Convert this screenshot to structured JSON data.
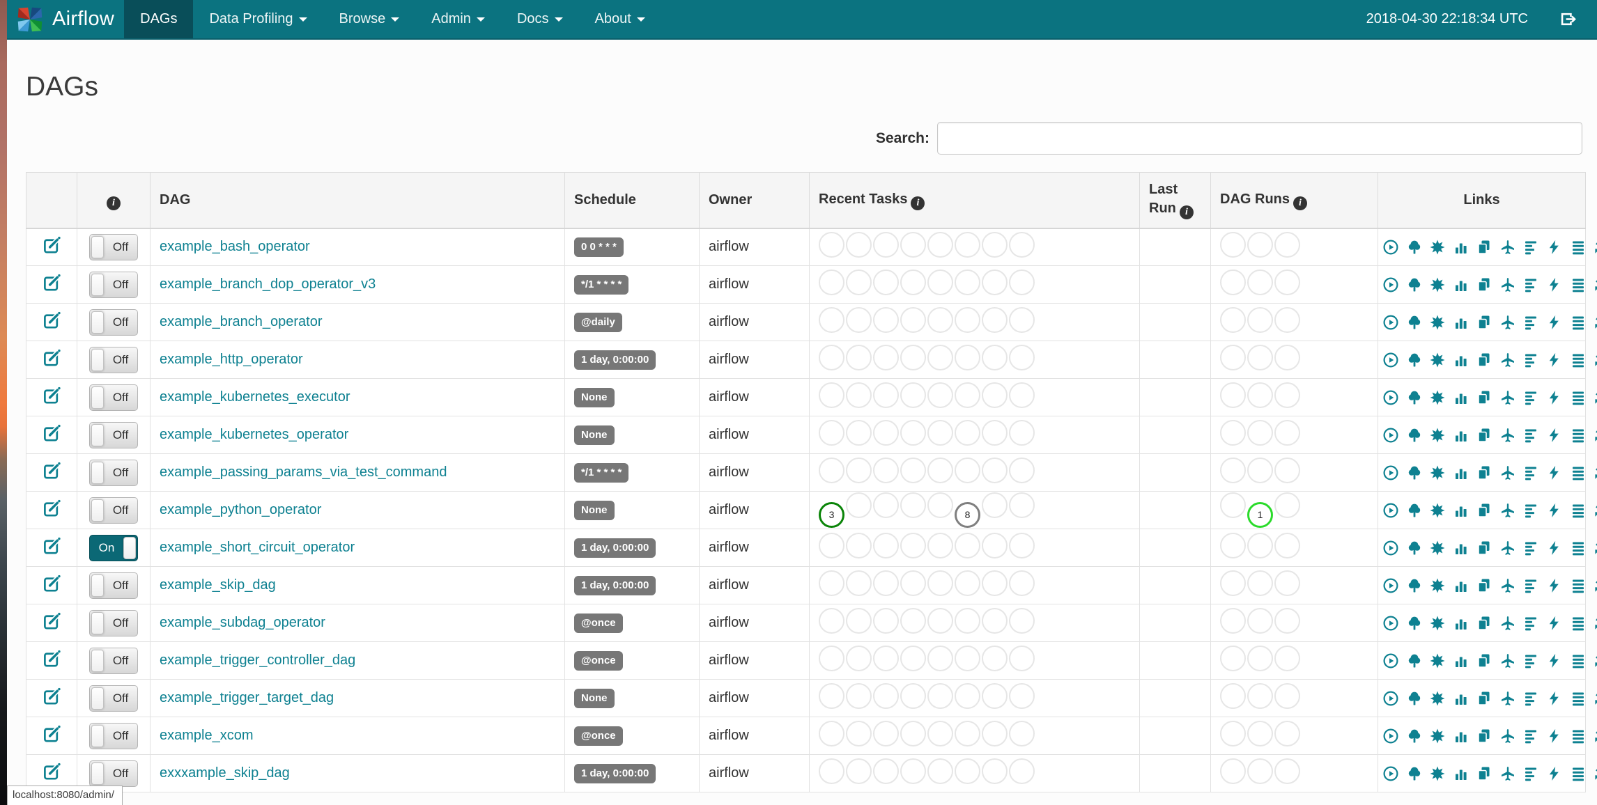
{
  "navbar": {
    "brand": "Airflow",
    "items": [
      {
        "label": "DAGs",
        "active": true,
        "dropdown": false
      },
      {
        "label": "Data Profiling",
        "active": false,
        "dropdown": true
      },
      {
        "label": "Browse",
        "active": false,
        "dropdown": true
      },
      {
        "label": "Admin",
        "active": false,
        "dropdown": true
      },
      {
        "label": "Docs",
        "active": false,
        "dropdown": true
      },
      {
        "label": "About",
        "active": false,
        "dropdown": true
      }
    ],
    "clock": "2018-04-30 22:18:34 UTC"
  },
  "page": {
    "title": "DAGs"
  },
  "search": {
    "label": "Search:",
    "value": "",
    "placeholder": ""
  },
  "table": {
    "headers": {
      "edit": "",
      "info": "i",
      "dag": "DAG",
      "schedule": "Schedule",
      "owner": "Owner",
      "recent_tasks": "Recent Tasks",
      "last_run": "Last Run",
      "dag_runs": "DAG Runs",
      "links": "Links"
    },
    "recent_task_slots": 8,
    "dag_run_slots": 3,
    "state_colors": {
      "success": "#0a8408",
      "queued": "#7f7f7f",
      "running": "#2bdb2b",
      "empty": "#e6e6e6"
    },
    "link_actions": [
      "trigger-dag",
      "tree-view",
      "graph-view",
      "task-duration",
      "task-tries",
      "landing-times",
      "gantt-view",
      "code-view",
      "logs",
      "refresh"
    ],
    "rows": [
      {
        "toggle": "Off",
        "dag": "example_bash_operator",
        "schedule": "0 0 * * *",
        "owner": "airflow",
        "recent_tasks": [],
        "dag_runs": [],
        "last_run": ""
      },
      {
        "toggle": "Off",
        "dag": "example_branch_dop_operator_v3",
        "schedule": "*/1 * * * *",
        "owner": "airflow",
        "recent_tasks": [],
        "dag_runs": [],
        "last_run": ""
      },
      {
        "toggle": "Off",
        "dag": "example_branch_operator",
        "schedule": "@daily",
        "owner": "airflow",
        "recent_tasks": [],
        "dag_runs": [],
        "last_run": ""
      },
      {
        "toggle": "Off",
        "dag": "example_http_operator",
        "schedule": "1 day, 0:00:00",
        "owner": "airflow",
        "recent_tasks": [],
        "dag_runs": [],
        "last_run": ""
      },
      {
        "toggle": "Off",
        "dag": "example_kubernetes_executor",
        "schedule": "None",
        "owner": "airflow",
        "recent_tasks": [],
        "dag_runs": [],
        "last_run": ""
      },
      {
        "toggle": "Off",
        "dag": "example_kubernetes_operator",
        "schedule": "None",
        "owner": "airflow",
        "recent_tasks": [],
        "dag_runs": [],
        "last_run": ""
      },
      {
        "toggle": "Off",
        "dag": "example_passing_params_via_test_command",
        "schedule": "*/1 * * * *",
        "owner": "airflow",
        "recent_tasks": [],
        "dag_runs": [],
        "last_run": ""
      },
      {
        "toggle": "Off",
        "dag": "example_python_operator",
        "schedule": "None",
        "owner": "airflow",
        "recent_tasks": [
          {
            "slot": 0,
            "count": 3,
            "state": "success"
          },
          {
            "slot": 5,
            "count": 8,
            "state": "queued"
          }
        ],
        "dag_runs": [
          {
            "slot": 1,
            "count": 1,
            "state": "running"
          }
        ],
        "last_run": ""
      },
      {
        "toggle": "On",
        "dag": "example_short_circuit_operator",
        "schedule": "1 day, 0:00:00",
        "owner": "airflow",
        "recent_tasks": [],
        "dag_runs": [],
        "last_run": ""
      },
      {
        "toggle": "Off",
        "dag": "example_skip_dag",
        "schedule": "1 day, 0:00:00",
        "owner": "airflow",
        "recent_tasks": [],
        "dag_runs": [],
        "last_run": ""
      },
      {
        "toggle": "Off",
        "dag": "example_subdag_operator",
        "schedule": "@once",
        "owner": "airflow",
        "recent_tasks": [],
        "dag_runs": [],
        "last_run": ""
      },
      {
        "toggle": "Off",
        "dag": "example_trigger_controller_dag",
        "schedule": "@once",
        "owner": "airflow",
        "recent_tasks": [],
        "dag_runs": [],
        "last_run": ""
      },
      {
        "toggle": "Off",
        "dag": "example_trigger_target_dag",
        "schedule": "None",
        "owner": "airflow",
        "recent_tasks": [],
        "dag_runs": [],
        "last_run": ""
      },
      {
        "toggle": "Off",
        "dag": "example_xcom",
        "schedule": "@once",
        "owner": "airflow",
        "recent_tasks": [],
        "dag_runs": [],
        "last_run": ""
      },
      {
        "toggle": "Off",
        "dag": "exxxample_skip_dag",
        "schedule": "1 day, 0:00:00",
        "owner": "airflow",
        "recent_tasks": [],
        "dag_runs": [],
        "last_run": ""
      }
    ]
  },
  "status_bar": {
    "text": "localhost:8080/admin/"
  },
  "colors": {
    "navbar": "#0B7380",
    "navbar_active": "#094E59",
    "accent": "#0E8191",
    "schedule_badge": "#777777"
  }
}
